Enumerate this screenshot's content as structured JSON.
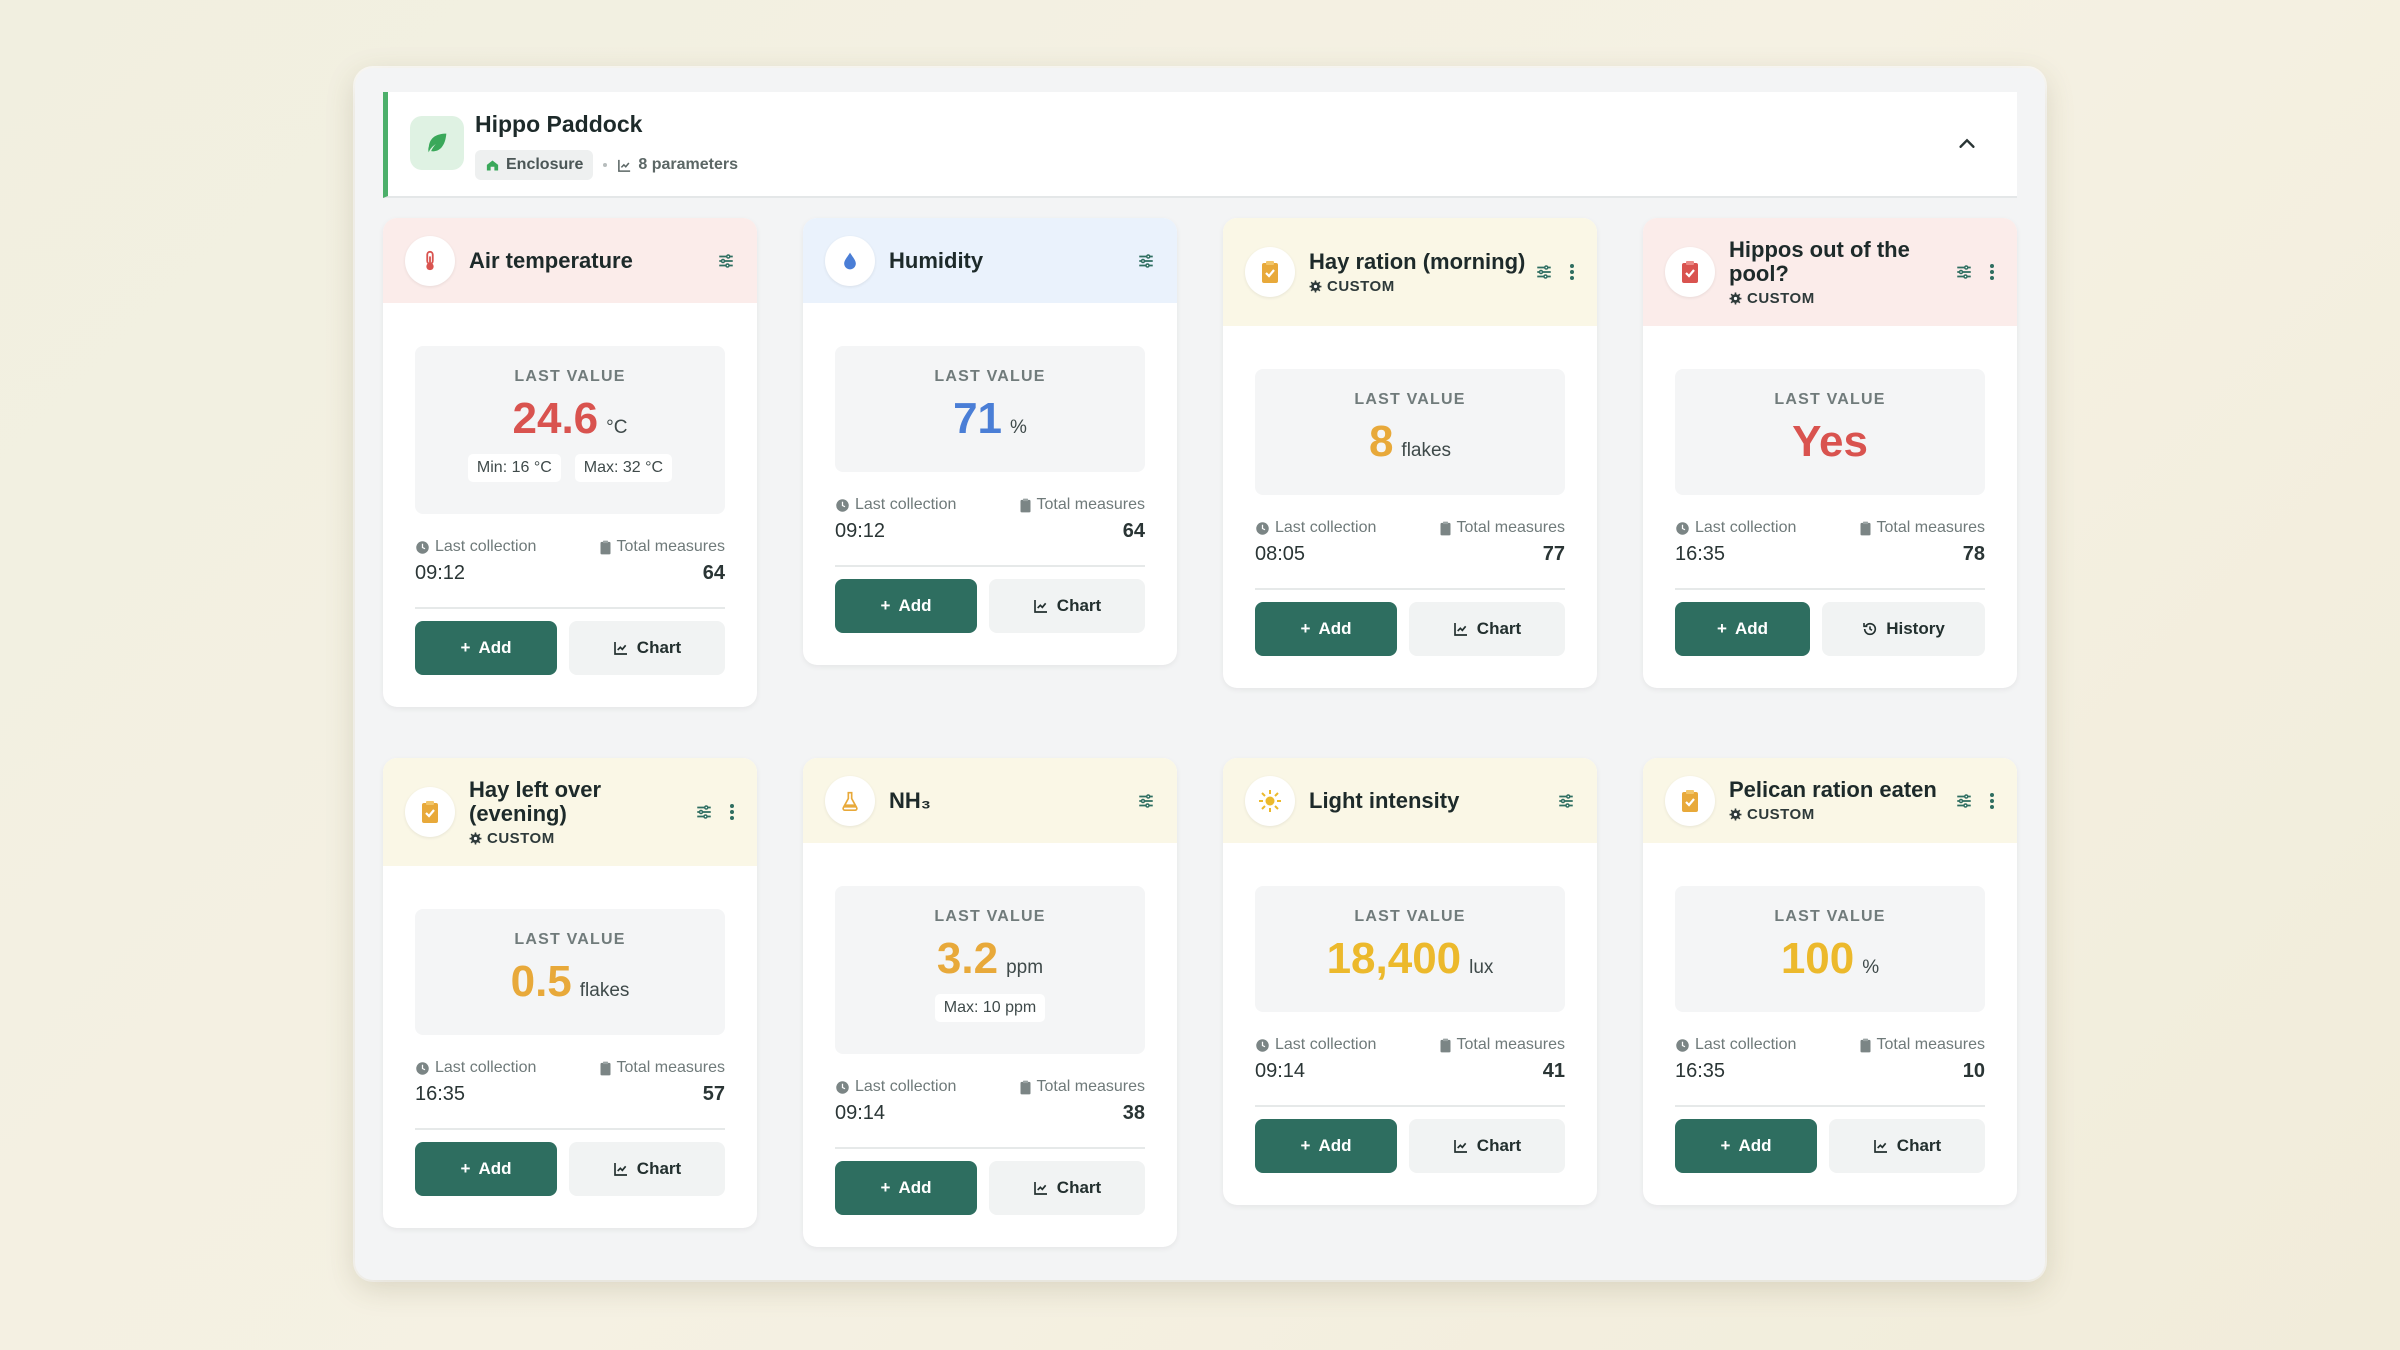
{
  "header": {
    "title": "Hippo Paddock",
    "type_label": "Enclosure",
    "params_label": "8 parameters"
  },
  "labels": {
    "last_value": "LAST VALUE",
    "last_collection": "Last collection",
    "total_measures": "Total measures",
    "add": "Add",
    "chart": "Chart",
    "history": "History",
    "custom": "CUSTOM"
  },
  "colors": {
    "accent": "#2e6e60",
    "header_border": "#4caf6a",
    "red": "#d9534f",
    "blue": "#4a7ed6",
    "yellow": "#e8a93a"
  },
  "cards": [
    {
      "name": "Air temperature",
      "icon": "thermometer-icon",
      "value": "24.6",
      "unit": "°C",
      "min": "Min: 16 °C",
      "max": "Max: 32 °C",
      "time": "09:12",
      "count": "64",
      "secondary": "Chart"
    },
    {
      "name": "Humidity",
      "icon": "water-drop-icon",
      "value": "71",
      "unit": "%",
      "time": "09:12",
      "count": "64",
      "secondary": "Chart"
    },
    {
      "name": "Hay ration (morning)",
      "icon": "clipboard-check-icon",
      "value": "8",
      "unit": "flakes",
      "time": "08:05",
      "count": "77",
      "secondary": "Chart",
      "custom": true
    },
    {
      "name": "Hippos out of the pool?",
      "icon": "clipboard-check-icon",
      "value": "Yes",
      "unit": "",
      "time": "16:35",
      "count": "78",
      "secondary": "History",
      "custom": true
    },
    {
      "name": "Hay left over (evening)",
      "icon": "clipboard-check-icon",
      "value": "0.5",
      "unit": "flakes",
      "time": "16:35",
      "count": "57",
      "secondary": "Chart",
      "custom": true
    },
    {
      "name": "NH₃",
      "icon": "flask-icon",
      "value": "3.2",
      "unit": "ppm",
      "max": "Max: 10 ppm",
      "time": "09:14",
      "count": "38",
      "secondary": "Chart"
    },
    {
      "name": "Light intensity",
      "icon": "sun-icon",
      "value": "18,400",
      "unit": "lux",
      "time": "09:14",
      "count": "41",
      "secondary": "Chart"
    },
    {
      "name": "Pelican ration eaten",
      "icon": "clipboard-check-icon",
      "value": "100",
      "unit": "%",
      "time": "16:35",
      "count": "10",
      "secondary": "Chart",
      "custom": true
    }
  ]
}
